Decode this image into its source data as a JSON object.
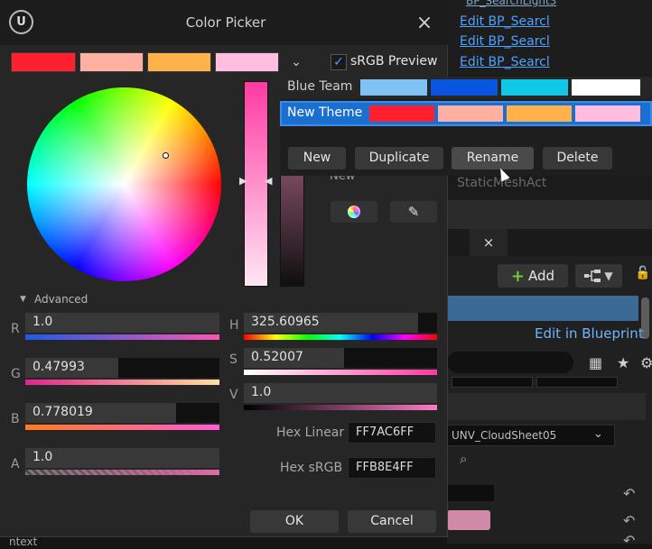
{
  "background": {
    "links": [
      "Edit BP_Searcl",
      "Edit BP_Searcl",
      "Edit BP_Searcl",
      "Edit BP_Searcl"
    ],
    "top_cut_text": "BP_SearchLight3",
    "static_label": "StaticMeshAct",
    "tab_close": "×",
    "add_label": "Add",
    "edit_in_blueprint": "Edit in Blueprint",
    "cloud_sheet": "UNV_CloudSheet05",
    "bottom_text": "ntext"
  },
  "dialog": {
    "title": "Color Picker",
    "close": "×",
    "ue_logo": "U",
    "theme_swatches": [
      "#ff1f2e",
      "#ffb0a0",
      "#ffb14a",
      "#ffbde0"
    ],
    "srgb_checked": "✓",
    "srgb_label": "sRGB Preview",
    "new_label": "New",
    "pipette": "✎",
    "advanced_label": "Advanced",
    "channels": {
      "r": {
        "label": "R",
        "value": "1.0",
        "fill": 1.0
      },
      "g": {
        "label": "G",
        "value": "0.47993",
        "fill": 0.47993
      },
      "b": {
        "label": "B",
        "value": "0.778019",
        "fill": 0.778019
      },
      "a": {
        "label": "A",
        "value": "1.0",
        "fill": 1.0
      },
      "h": {
        "label": "H",
        "value": "325.60965",
        "fill": 0.904
      },
      "s": {
        "label": "S",
        "value": "0.52007",
        "fill": 0.52007
      },
      "v": {
        "label": "V",
        "value": "1.0",
        "fill": 1.0
      }
    },
    "hex_linear_label": "Hex Linear",
    "hex_linear": "FF7AC6FF",
    "hex_srgb_label": "Hex sRGB",
    "hex_srgb": "FFB8E4FF",
    "ok": "OK",
    "cancel": "Cancel"
  },
  "themes": {
    "rows": [
      {
        "name": "Blue Team",
        "swatches": [
          "#7fc3f5",
          "#0a55e0",
          "#10c7e6",
          "#ffffff"
        ]
      },
      {
        "name": "New Theme",
        "swatches": [
          "#ff1f2e",
          "#ffb0a0",
          "#ffb14a",
          "#ffbde0"
        ]
      }
    ],
    "buttons": {
      "new": "New",
      "duplicate": "Duplicate",
      "rename": "Rename",
      "delete": "Delete"
    }
  },
  "colors": {
    "accent": "#1a6fd1",
    "link": "#4da3ff"
  }
}
